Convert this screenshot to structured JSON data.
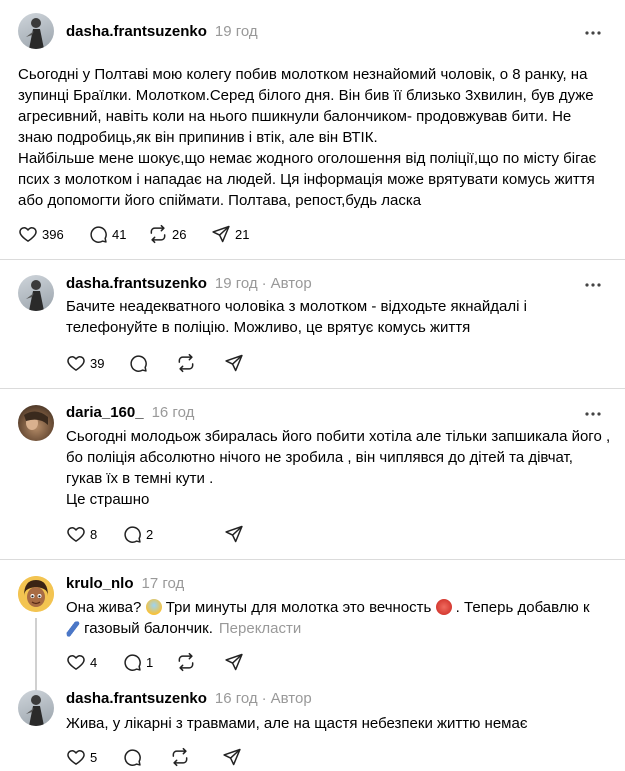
{
  "posts": [
    {
      "username": "dasha.frantsuzenko",
      "time": "19 год",
      "author_tag": "",
      "text": "Сьогодні у Полтаві мою колегу побив молотком незнайомий чоловік, о 8 ранку, на\nзупинці Браїлки. Молотком.Серед білого дня. Він бив її близько 3хвилин, був дуже\nагресивний, навіть коли на нього пшикнули балончиком- продовжував бити. Не\nзнаю подробиць,як він припинив і втік, але він ВТІК.\nНайбільше мене шокує,що немає жодного оголошення від поліції,що по місту бігає\nпсих з молотком і нападає на людей. Ця інформація може врятувати комусь життя\nабо допомогти його спіймати. Полтава, репост,будь ласка",
      "likes": "396",
      "comments": "41",
      "reposts": "26",
      "shares": "21"
    },
    {
      "username": "dasha.frantsuzenko",
      "time": "19 год",
      "author_tag": "Автор",
      "text": "Бачите неадекватного чоловіка з молотком - відходьте якнайдалі і\nтелефонуйте в поліцію. Можливо, це врятує комусь життя",
      "likes": "39",
      "comments": "",
      "reposts": "",
      "shares": ""
    },
    {
      "username": "daria_160_",
      "time": "16 год",
      "author_tag": "",
      "text": "Сьогодні молодьож збиралась його побити хотіла але тільки запшикала його ,\nбо поліція абсолютно нічого не зробила , він чиплявся до дітей та дівчат,\nгукав їх в темні кути .\nЦе страшно",
      "likes": "8",
      "comments": "2",
      "reposts": "",
      "shares": ""
    },
    {
      "username": "krulo_nlo",
      "time": "17 год",
      "author_tag": "",
      "text_part1": "Она жива? ",
      "text_part2": " Три минуты для молотка это вечность ",
      "text_part3": " . Теперь добавлю к",
      "text_part4": " газовый балончик.",
      "translate": "Перекласти",
      "likes": "4",
      "comments": "1",
      "reposts": "",
      "shares": ""
    },
    {
      "username": "dasha.frantsuzenko",
      "time": "16 год",
      "author_tag": "Автор",
      "text": "Жива, у лікарні з травмами, але на щастя небезпеки життю немає",
      "likes": "5",
      "comments": "",
      "reposts": "",
      "shares": ""
    }
  ],
  "icons": {
    "like": "heart-icon",
    "comment": "comment-bubble-icon",
    "repost": "repost-icon",
    "share": "send-icon",
    "more": "more-dots-icon"
  },
  "colors": {
    "muted": "#999999",
    "separator": "#dbdbdb"
  }
}
